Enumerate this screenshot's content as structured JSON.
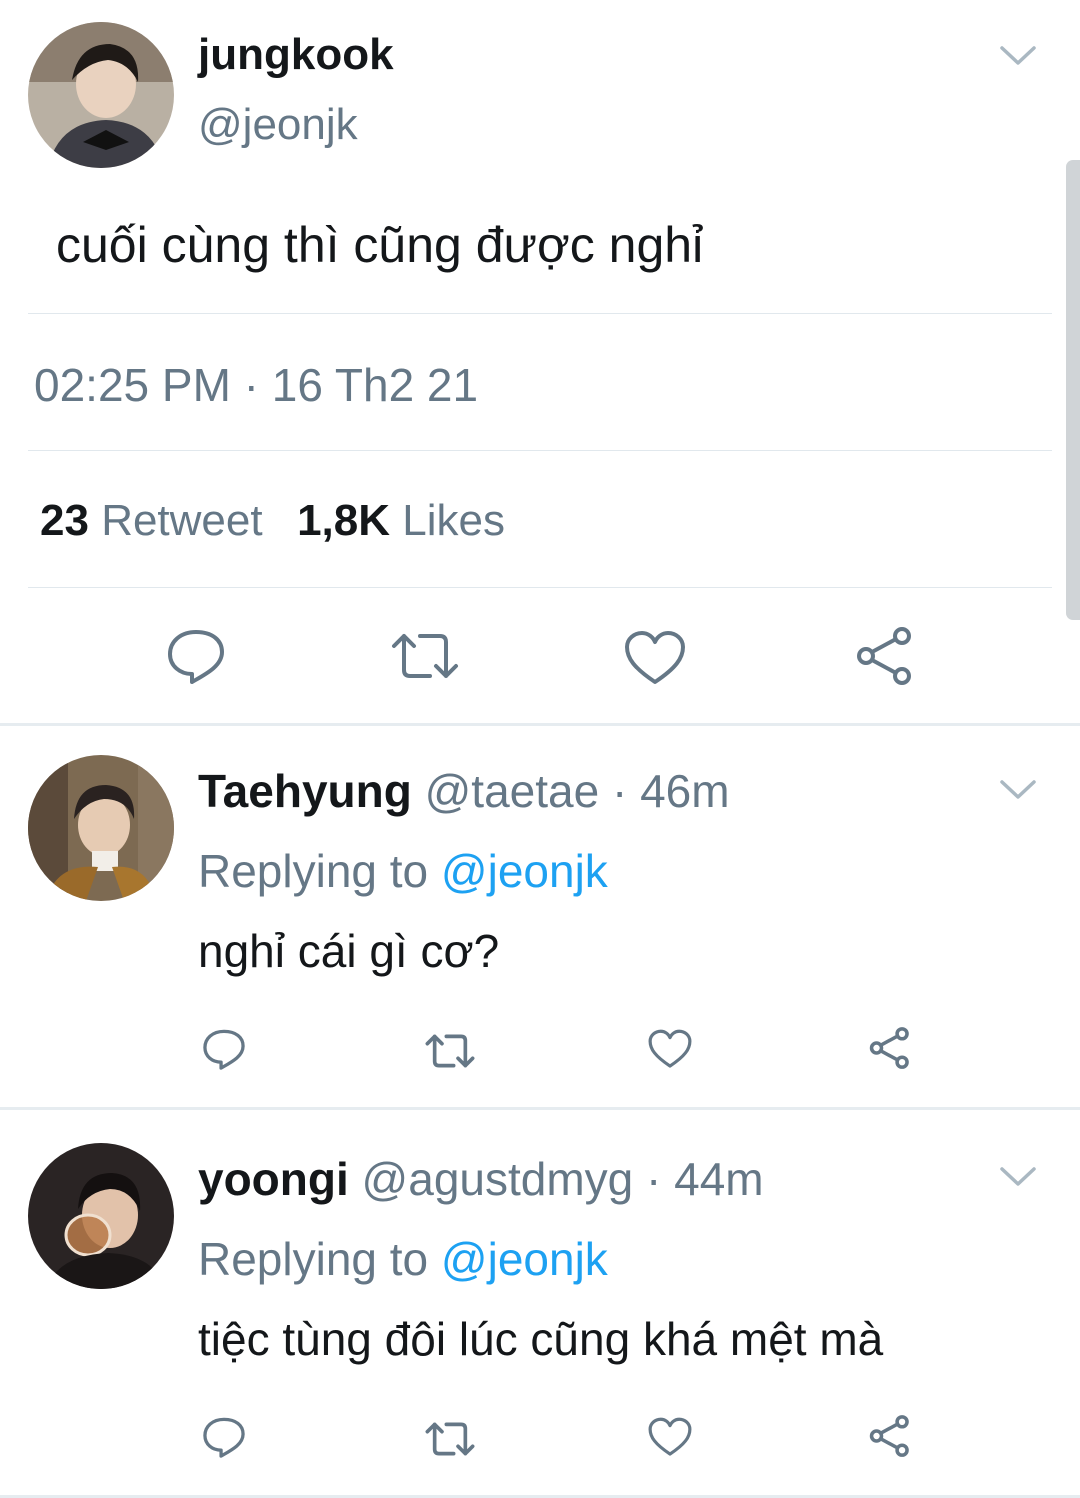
{
  "main_tweet": {
    "name": "jungkook",
    "handle": "@jeonjk",
    "text": "cuối cùng thì cũng được nghỉ",
    "timestamp": "02:25 PM · 16 Th2 21",
    "retweet_count": "23",
    "retweet_label": "Retweet",
    "like_count": "1,8K",
    "like_label": "Likes"
  },
  "replies": [
    {
      "name": "Taehyung",
      "handle": "@taetae",
      "time": "· 46m",
      "replying_prefix": "Replying to",
      "replying_handle": "@jeonjk",
      "text": "nghỉ cái gì cơ?"
    },
    {
      "name": "yoongi",
      "handle": "@agustdmyg",
      "time": "· 44m",
      "replying_prefix": "Replying to",
      "replying_handle": "@jeonjk",
      "text": "tiệc tùng đôi lúc cũng khá mệt mà"
    }
  ],
  "colors": {
    "accent": "#1da1f2",
    "secondary_text": "#657786",
    "icon": "#657786",
    "divider": "#e1e8ed"
  },
  "icons": [
    "chevron-down-icon",
    "reply-icon",
    "retweet-icon",
    "like-icon",
    "share-icon"
  ]
}
